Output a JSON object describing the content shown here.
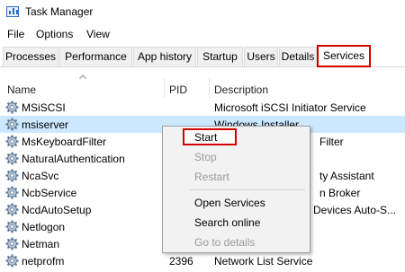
{
  "window": {
    "title": "Task Manager"
  },
  "menu": {
    "file": "File",
    "options": "Options",
    "view": "View"
  },
  "tabs": [
    {
      "label": "Processes"
    },
    {
      "label": "Performance"
    },
    {
      "label": "App history"
    },
    {
      "label": "Startup"
    },
    {
      "label": "Users"
    },
    {
      "label": "Details"
    },
    {
      "label": "Services"
    }
  ],
  "active_tab": "Services",
  "columns": {
    "name": "Name",
    "pid": "PID",
    "description": "Description"
  },
  "rows": [
    {
      "name": "MSiSCSI",
      "pid": "",
      "description": "Microsoft iSCSI Initiator Service"
    },
    {
      "name": "msiserver",
      "pid": "",
      "description": "Windows Installer"
    },
    {
      "name": "MsKeyboardFilter",
      "pid": "",
      "description": "Filter"
    },
    {
      "name": "NaturalAuthentication",
      "pid": "",
      "description": ""
    },
    {
      "name": "NcaSvc",
      "pid": "",
      "description": "ty Assistant"
    },
    {
      "name": "NcbService",
      "pid": "",
      "description": "n Broker"
    },
    {
      "name": "NcdAutoSetup",
      "pid": "",
      "description": "Devices Auto-S..."
    },
    {
      "name": "Netlogon",
      "pid": "",
      "description": ""
    },
    {
      "name": "Netman",
      "pid": "",
      "description": ""
    },
    {
      "name": "netprofm",
      "pid": "2396",
      "description": "Network List Service"
    }
  ],
  "selected_row": "msiserver",
  "context_menu": {
    "start": "Start",
    "stop": "Stop",
    "restart": "Restart",
    "open_services": "Open Services",
    "search_online": "Search online",
    "go_to_details": "Go to details"
  },
  "colors": {
    "highlight": "#d40000",
    "selection": "#cce8ff",
    "icon": "#2a6ebb"
  }
}
